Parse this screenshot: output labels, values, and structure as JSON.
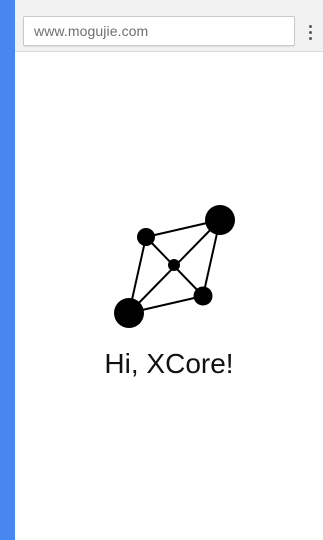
{
  "browser": {
    "url": "www.mogujie.com",
    "menu_icon": "more-vert-icon"
  },
  "page": {
    "logo_icon": "network-graph-logo",
    "greeting": "Hi, XCore!"
  },
  "colors": {
    "frame_background": "#4a86f0",
    "toolbar_background": "#f2f2f2",
    "page_background": "#ffffff",
    "logo": "#000000"
  }
}
